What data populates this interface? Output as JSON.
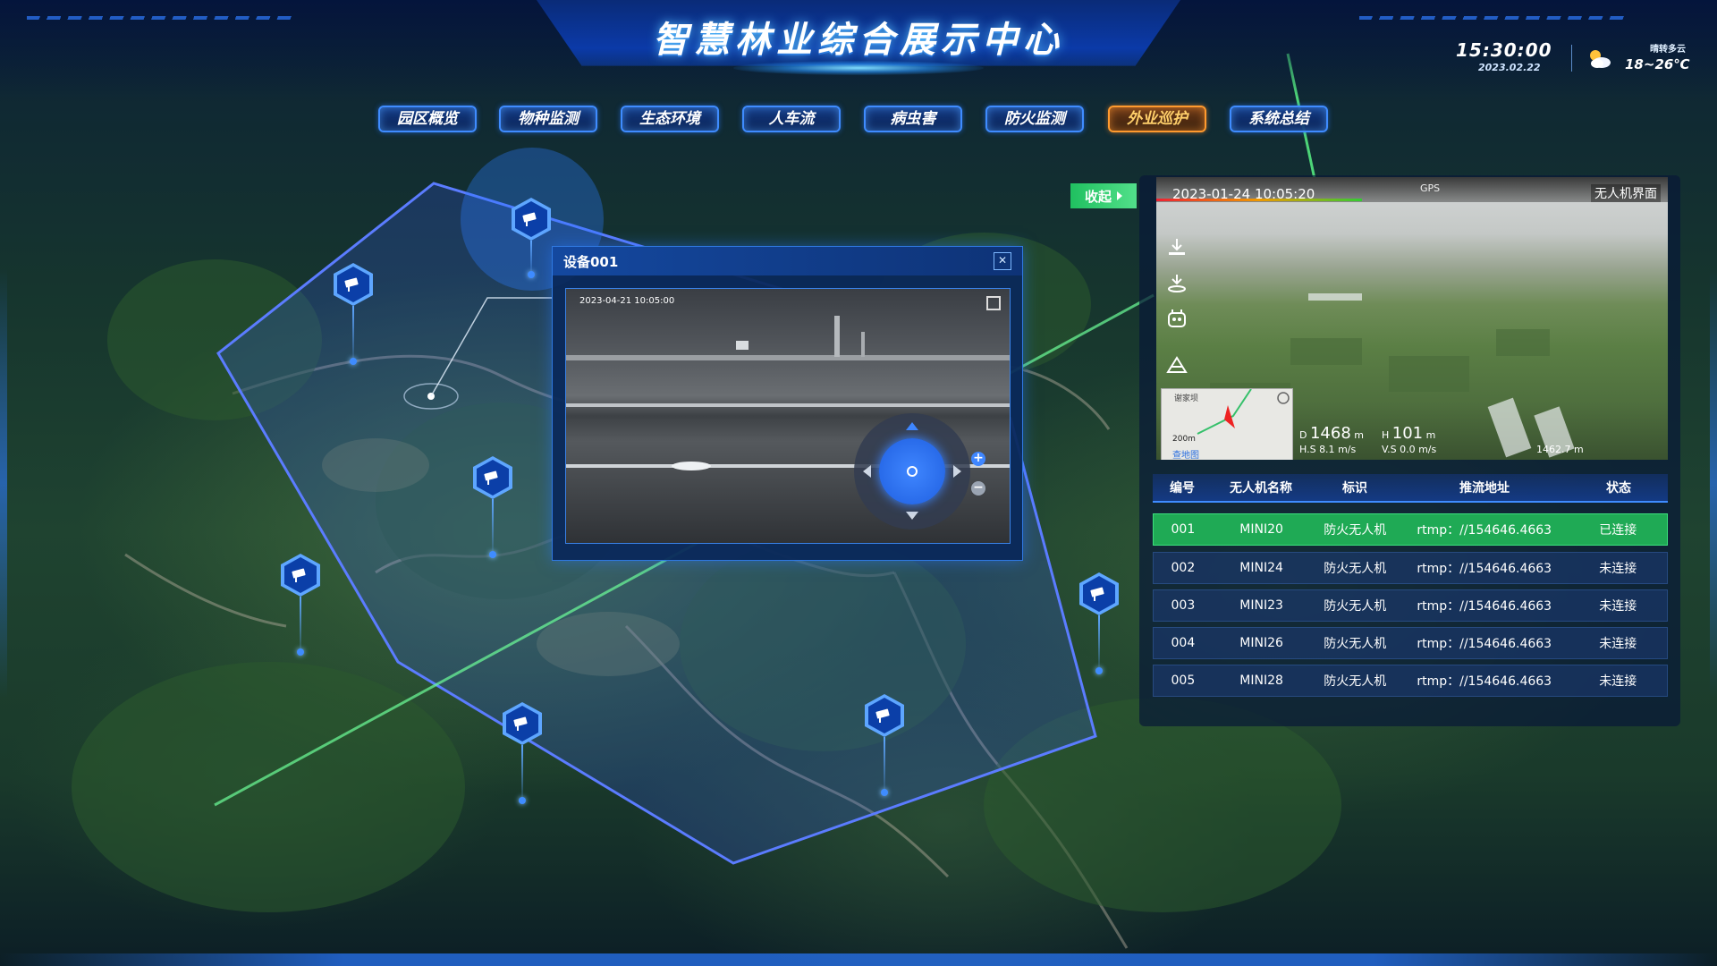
{
  "header": {
    "title": "智慧林业综合展示中心",
    "time": "15:30:00",
    "date": "2023.02.22",
    "weather_desc": "晴转多云",
    "weather_temp": "18~26℃",
    "weather_icon": "partly-cloudy-icon"
  },
  "nav": {
    "items": [
      {
        "label": "园区概览"
      },
      {
        "label": "物种监测"
      },
      {
        "label": "生态环境"
      },
      {
        "label": "人车流"
      },
      {
        "label": "病虫害"
      },
      {
        "label": "防火监测"
      },
      {
        "label": "外业巡护",
        "active": true
      },
      {
        "label": "系统总结"
      }
    ]
  },
  "collapse": {
    "label": "收起"
  },
  "device_popup": {
    "title": "设备001",
    "video_timestamp": "2023-04-21  10:05:00"
  },
  "drone_view": {
    "timestamp": "2023-01-24  10:05:20",
    "gps": "GPS",
    "label": "无人机界面",
    "minimap_label": "谢家坝",
    "minimap_scale": "200m",
    "minimap_link": "查地图",
    "distance_value": "1468",
    "distance_unit": "m",
    "height_value": "101",
    "height_unit": "m",
    "hs_label": "H.S",
    "hs_value": "8.1",
    "hs_unit": "m/s",
    "vs_label": "V.S",
    "vs_value": "0.0",
    "vs_unit": "m/s",
    "alt_value": "1462.7",
    "alt_unit": "m"
  },
  "drone_table": {
    "headers": [
      "编号",
      "无人机名称",
      "标识",
      "推流地址",
      "状态"
    ],
    "rows": [
      {
        "id": "001",
        "name": "MINI20",
        "tag": "防火无人机",
        "url": "rtmp：//154646.4663",
        "status": "已连接",
        "selected": true
      },
      {
        "id": "002",
        "name": "MINI24",
        "tag": "防火无人机",
        "url": "rtmp：//154646.4663",
        "status": "未连接"
      },
      {
        "id": "003",
        "name": "MINI23",
        "tag": "防火无人机",
        "url": "rtmp：//154646.4663",
        "status": "未连接"
      },
      {
        "id": "004",
        "name": "MINI26",
        "tag": "防火无人机",
        "url": "rtmp：//154646.4663",
        "status": "未连接"
      },
      {
        "id": "005",
        "name": "MINI28",
        "tag": "防火无人机",
        "url": "rtmp：//154646.4663",
        "status": "未连接"
      }
    ]
  },
  "colors": {
    "accent": "#3f8cff",
    "active_nav": "#ff9a2e",
    "connected": "#1faa55",
    "patrol_zone": "#4a6cff"
  }
}
